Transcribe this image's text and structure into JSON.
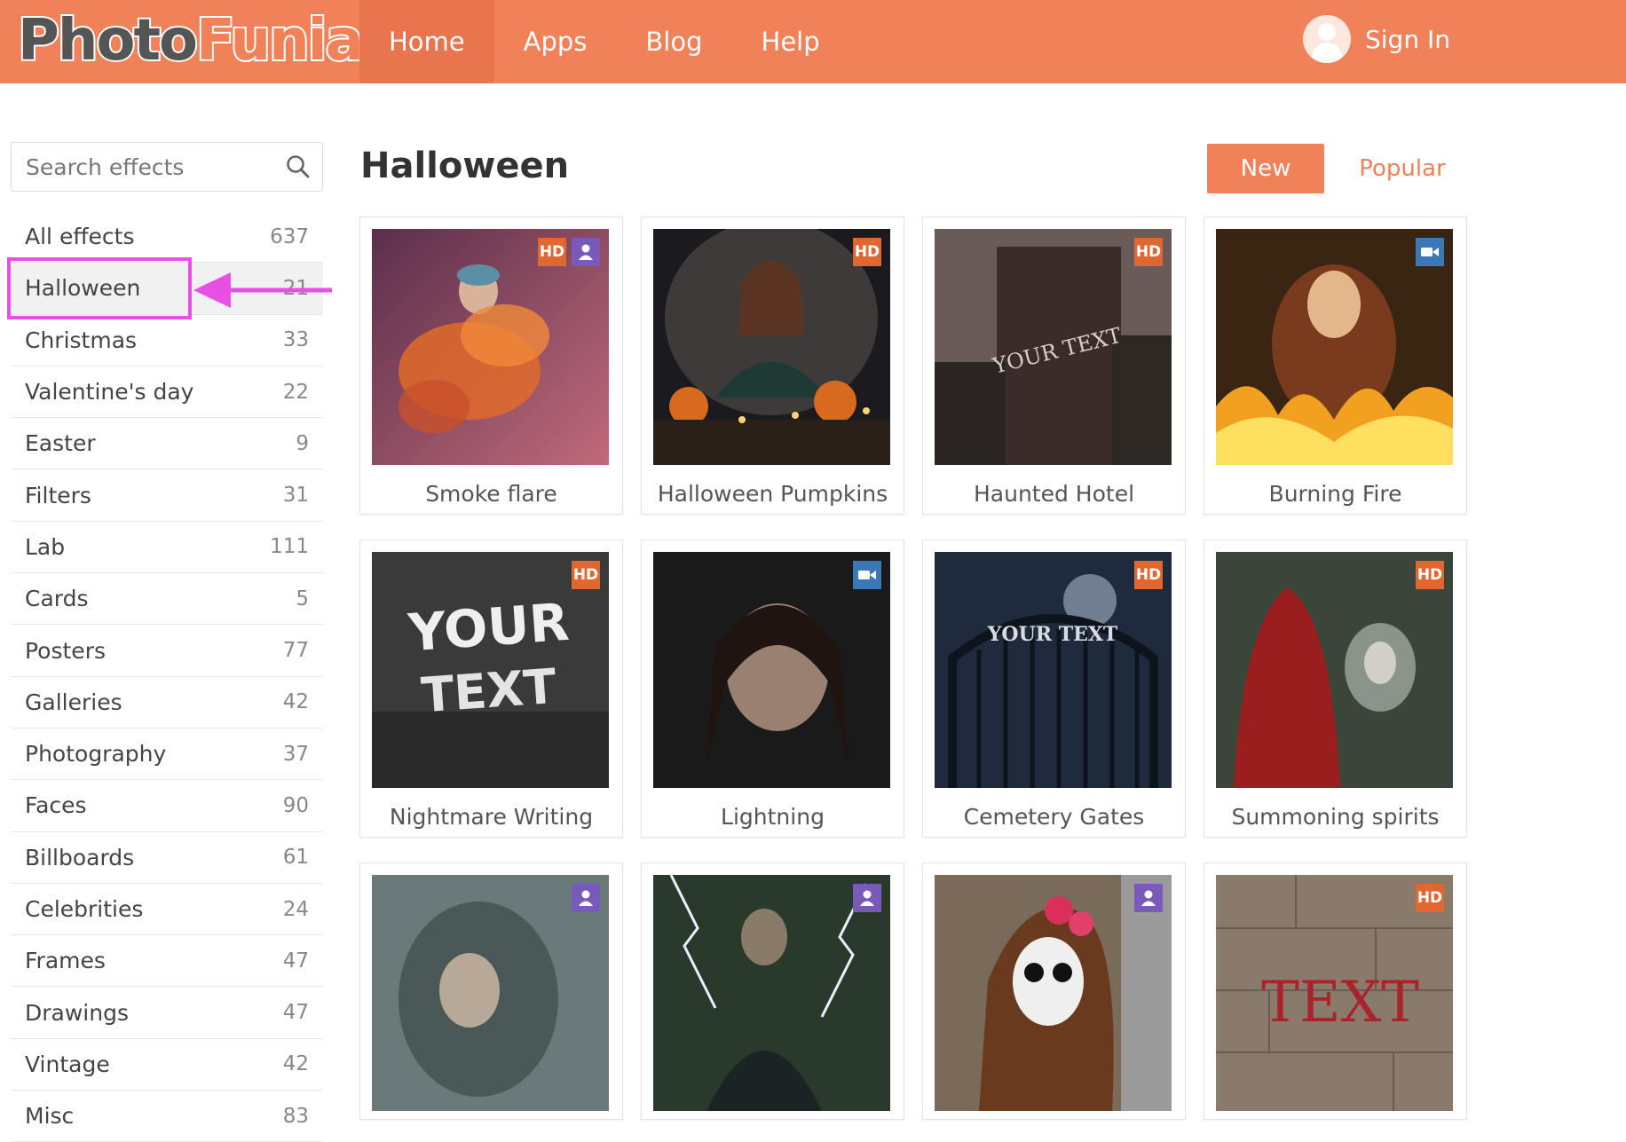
{
  "header": {
    "logo_part1": "Photo",
    "logo_part2": "Funia",
    "nav": [
      "Home",
      "Apps",
      "Blog",
      "Help"
    ],
    "signin_label": "Sign In"
  },
  "sidebar": {
    "search_placeholder": "Search effects",
    "categories": [
      {
        "name": "All effects",
        "count": "637"
      },
      {
        "name": "Halloween",
        "count": "21"
      },
      {
        "name": "Christmas",
        "count": "33"
      },
      {
        "name": "Valentine's day",
        "count": "22"
      },
      {
        "name": "Easter",
        "count": "9"
      },
      {
        "name": "Filters",
        "count": "31"
      },
      {
        "name": "Lab",
        "count": "111"
      },
      {
        "name": "Cards",
        "count": "5"
      },
      {
        "name": "Posters",
        "count": "77"
      },
      {
        "name": "Galleries",
        "count": "42"
      },
      {
        "name": "Photography",
        "count": "37"
      },
      {
        "name": "Faces",
        "count": "90"
      },
      {
        "name": "Billboards",
        "count": "61"
      },
      {
        "name": "Celebrities",
        "count": "24"
      },
      {
        "name": "Frames",
        "count": "47"
      },
      {
        "name": "Drawings",
        "count": "47"
      },
      {
        "name": "Vintage",
        "count": "42"
      },
      {
        "name": "Misc",
        "count": "83"
      }
    ]
  },
  "main": {
    "title": "Halloween",
    "sort_new": "New",
    "sort_popular": "Popular",
    "hd_label": "HD",
    "effects": [
      {
        "label": "Smoke flare",
        "badges": [
          "hd",
          "person"
        ]
      },
      {
        "label": "Halloween Pumpkins",
        "badges": [
          "hd"
        ]
      },
      {
        "label": "Haunted Hotel",
        "badges": [
          "hd"
        ]
      },
      {
        "label": "Burning Fire",
        "badges": [
          "video"
        ]
      },
      {
        "label": "Nightmare Writing",
        "badges": [
          "hd"
        ]
      },
      {
        "label": "Lightning",
        "badges": [
          "video"
        ]
      },
      {
        "label": "Cemetery Gates",
        "badges": [
          "hd"
        ]
      },
      {
        "label": "Summoning spirits",
        "badges": [
          "hd"
        ]
      },
      {
        "label": "",
        "badges": [
          "person"
        ]
      },
      {
        "label": "",
        "badges": [
          "person"
        ]
      },
      {
        "label": "",
        "badges": [
          "person"
        ]
      },
      {
        "label": "",
        "badges": [
          "hd"
        ]
      }
    ],
    "thumb_texts": {
      "hotel_text": "YOUR TEXT",
      "nightmare_line1": "YOUR",
      "nightmare_line2": "TEXT",
      "gate_text": "YOUR TEXT",
      "wall_text": "TEXT"
    }
  },
  "colors": {
    "brand": "#f08159",
    "highlight": "#e84fe3",
    "hd_badge": "#e0672f",
    "person_badge": "#7a5ab8",
    "video_badge": "#3a78b8"
  }
}
